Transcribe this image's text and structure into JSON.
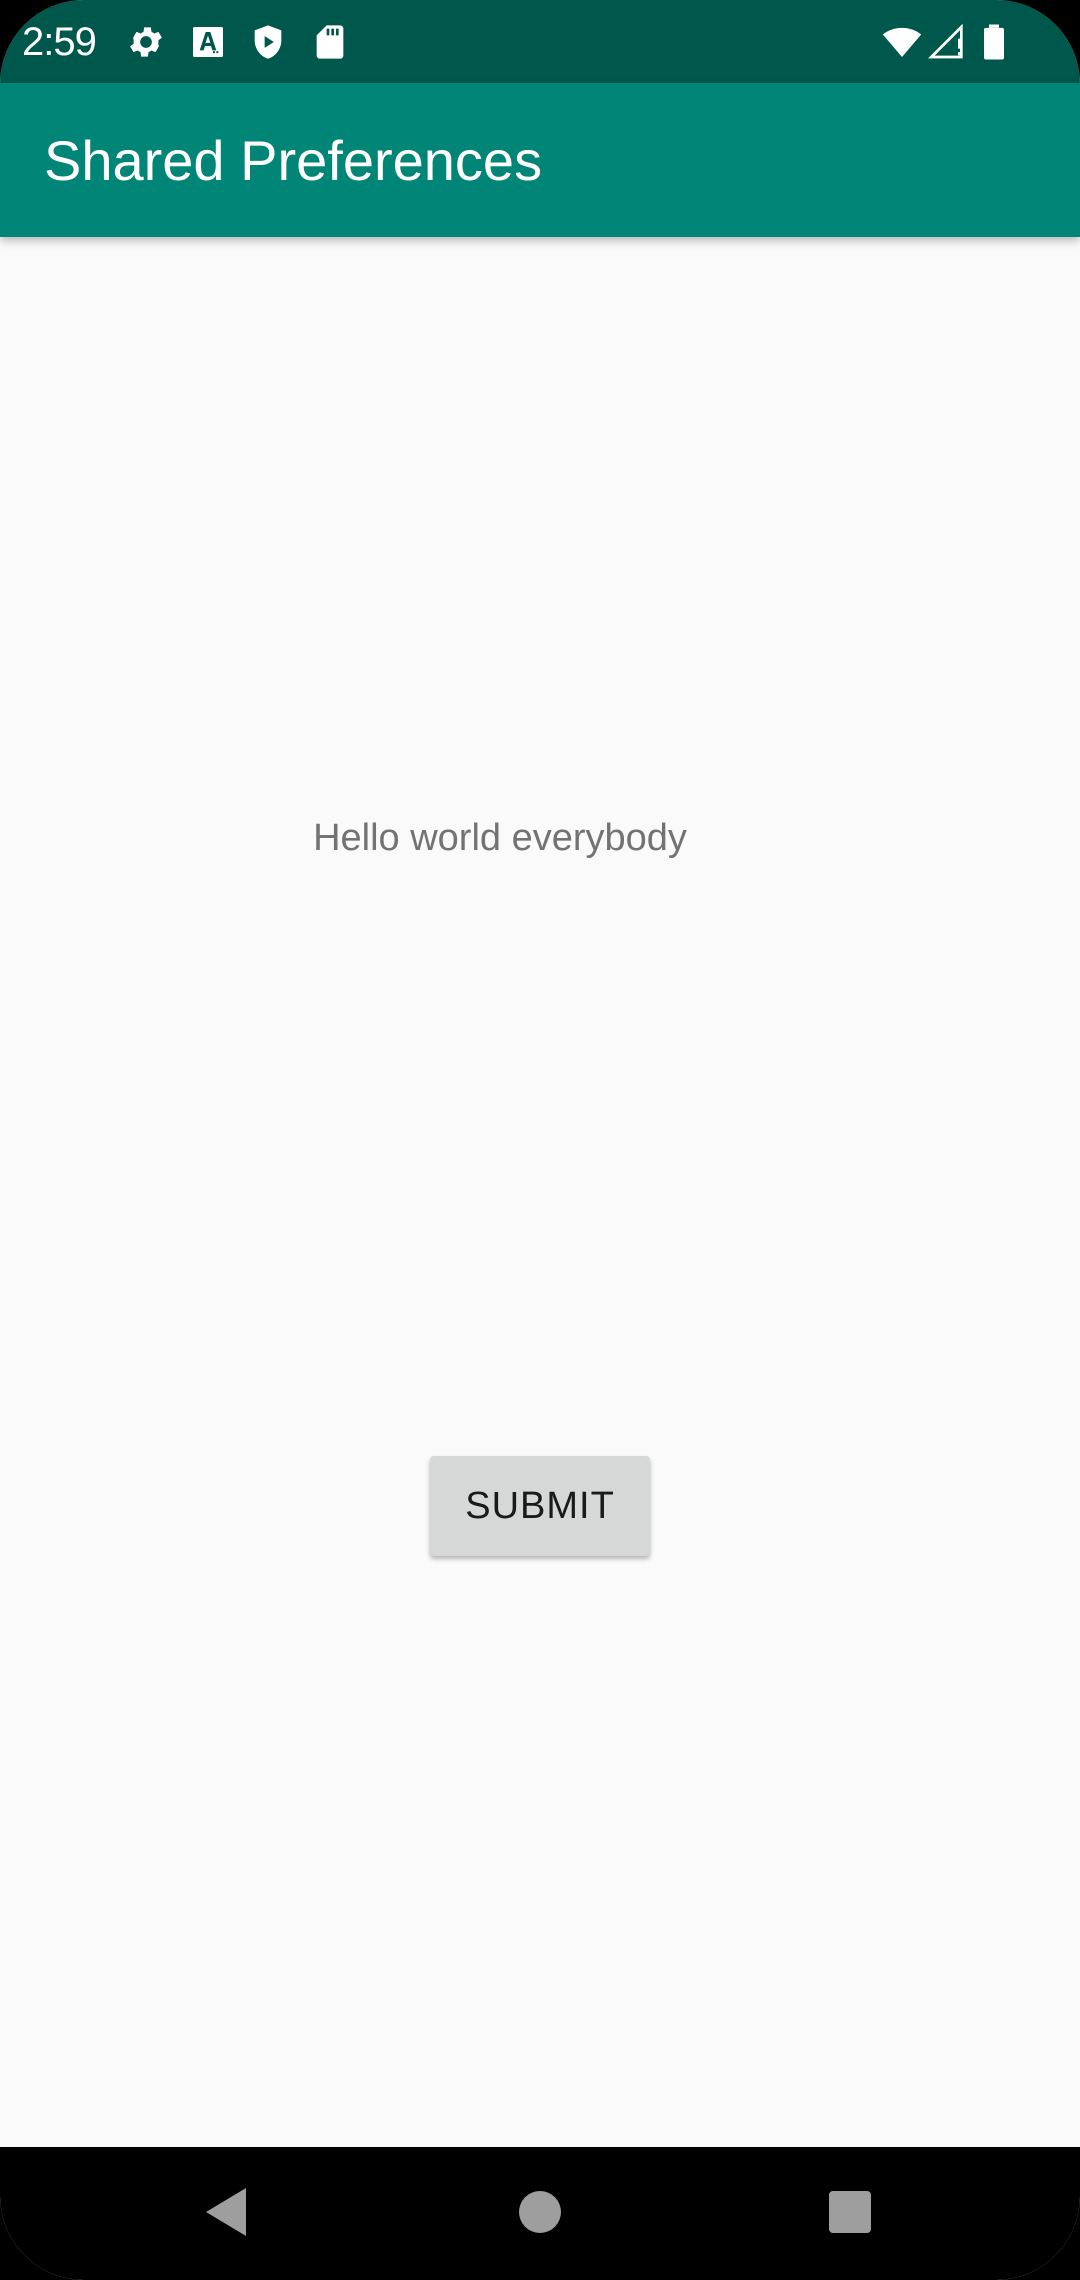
{
  "status_bar": {
    "time": "2:59",
    "left_icons": [
      "gear-icon",
      "text-a-icon",
      "shield-play-icon",
      "sd-card-icon"
    ],
    "right_icons": [
      "wifi-icon",
      "signal-icon",
      "battery-icon"
    ]
  },
  "app_bar": {
    "title": "Shared Preferences",
    "color": "#008577",
    "status_color": "#00574b"
  },
  "main": {
    "hello_text": "Hello world everybody",
    "submit_label": "SUBMIT"
  },
  "nav_bar": {
    "buttons": [
      "back",
      "home",
      "recent-apps"
    ]
  }
}
